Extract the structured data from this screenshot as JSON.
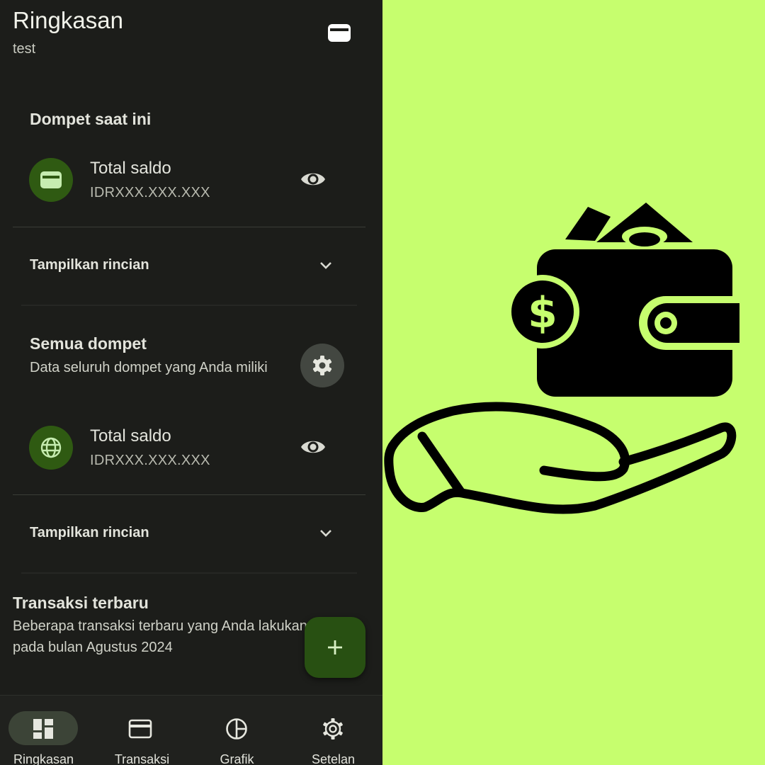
{
  "header": {
    "title": "Ringkasan",
    "subtitle": "test"
  },
  "current_wallet": {
    "title": "Dompet saat ini",
    "row_title": "Total saldo",
    "row_value": "IDRXXX.XXX.XXX",
    "details_label": "Tampilkan rincian"
  },
  "all_wallets": {
    "title": "Semua dompet",
    "description": "Data seluruh dompet yang Anda miliki",
    "row_title": "Total saldo",
    "row_value": "IDRXXX.XXX.XXX",
    "details_label": "Tampilkan rincian"
  },
  "recent_transactions": {
    "title": "Transaksi terbaru",
    "description": "Beberapa transaksi terbaru yang Anda lakukan pada bulan Agustus 2024"
  },
  "bottom_nav": {
    "items": [
      {
        "label": "Ringkasan",
        "icon": "dashboard-icon",
        "active": true
      },
      {
        "label": "Transaksi",
        "icon": "credit-card-icon",
        "active": false
      },
      {
        "label": "Grafik",
        "icon": "pie-chart-icon",
        "active": false
      },
      {
        "label": "Setelan",
        "icon": "gear-icon",
        "active": false
      }
    ]
  },
  "colors": {
    "background": "#1c1d1a",
    "accent": "#2f5a12",
    "fab": "#285012",
    "illustration_background": "#c6fe6e"
  }
}
